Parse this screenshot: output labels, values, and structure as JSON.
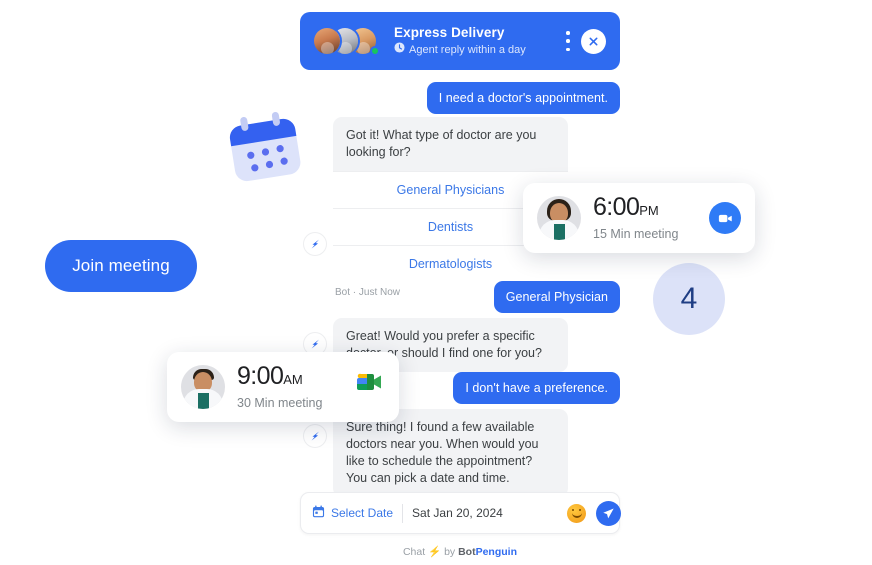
{
  "header": {
    "title": "Express Delivery",
    "subtitle": "Agent reply within a day",
    "clock_icon": "clock-icon",
    "menu_icon": "more-vertical-icon",
    "close_icon": "close-icon"
  },
  "messages": [
    {
      "id": "m1",
      "role": "user",
      "text": "I need a doctor's appointment."
    },
    {
      "id": "m2",
      "role": "bot",
      "text": "Got it! What type of doctor are you looking for?",
      "options": [
        "General Physicians",
        "Dentists",
        "Dermatologists"
      ],
      "meta": "Bot · Just Now"
    },
    {
      "id": "m3",
      "role": "user",
      "text": "General Physician"
    },
    {
      "id": "m4",
      "role": "bot",
      "text": "Great! Would you prefer a specific doctor, or should I find one for you?"
    },
    {
      "id": "m5",
      "role": "user",
      "text": "I don't have a preference."
    },
    {
      "id": "m6",
      "role": "bot",
      "text": "Sure thing! I found a few available doctors near you. When would you like to schedule the appointment? You can pick a date and time."
    }
  ],
  "composer": {
    "select_date_label": "Select Date",
    "calendar_icon": "calendar-icon",
    "date_value": "Sat Jan 20, 2024",
    "date_placeholder": "Sat Jan 20, 2024",
    "emoji_icon": "smiley-icon",
    "send_icon": "send-icon"
  },
  "footer": {
    "prefix": "Chat",
    "bolt": "⚡",
    "by": "by",
    "brand_dark": "Bot",
    "brand_blue": "Penguin"
  },
  "meeting_cards": [
    {
      "id": "evening",
      "time": "6:00",
      "ampm": "PM",
      "duration": "15 Min meeting",
      "action_icon": "zoom-video-icon",
      "avatar": "female-doctor-avatar"
    },
    {
      "id": "morning",
      "time": "9:00",
      "ampm": "AM",
      "duration": "30 Min meeting",
      "action_icon": "google-meet-icon",
      "avatar": "male-doctor-avatar"
    }
  ],
  "decor": {
    "join_button": "Join meeting",
    "calendar_art": "calendar-illustration",
    "badge_count": "4"
  },
  "colors": {
    "brand_blue": "#2F6BF0",
    "bot_bubble": "#F2F3F5",
    "link_blue": "#3B78E7",
    "badge_bg": "#DCE2F8",
    "badge_text": "#1F3E84",
    "online_green": "#18C55F",
    "emoji_orange": "#F5A623"
  }
}
